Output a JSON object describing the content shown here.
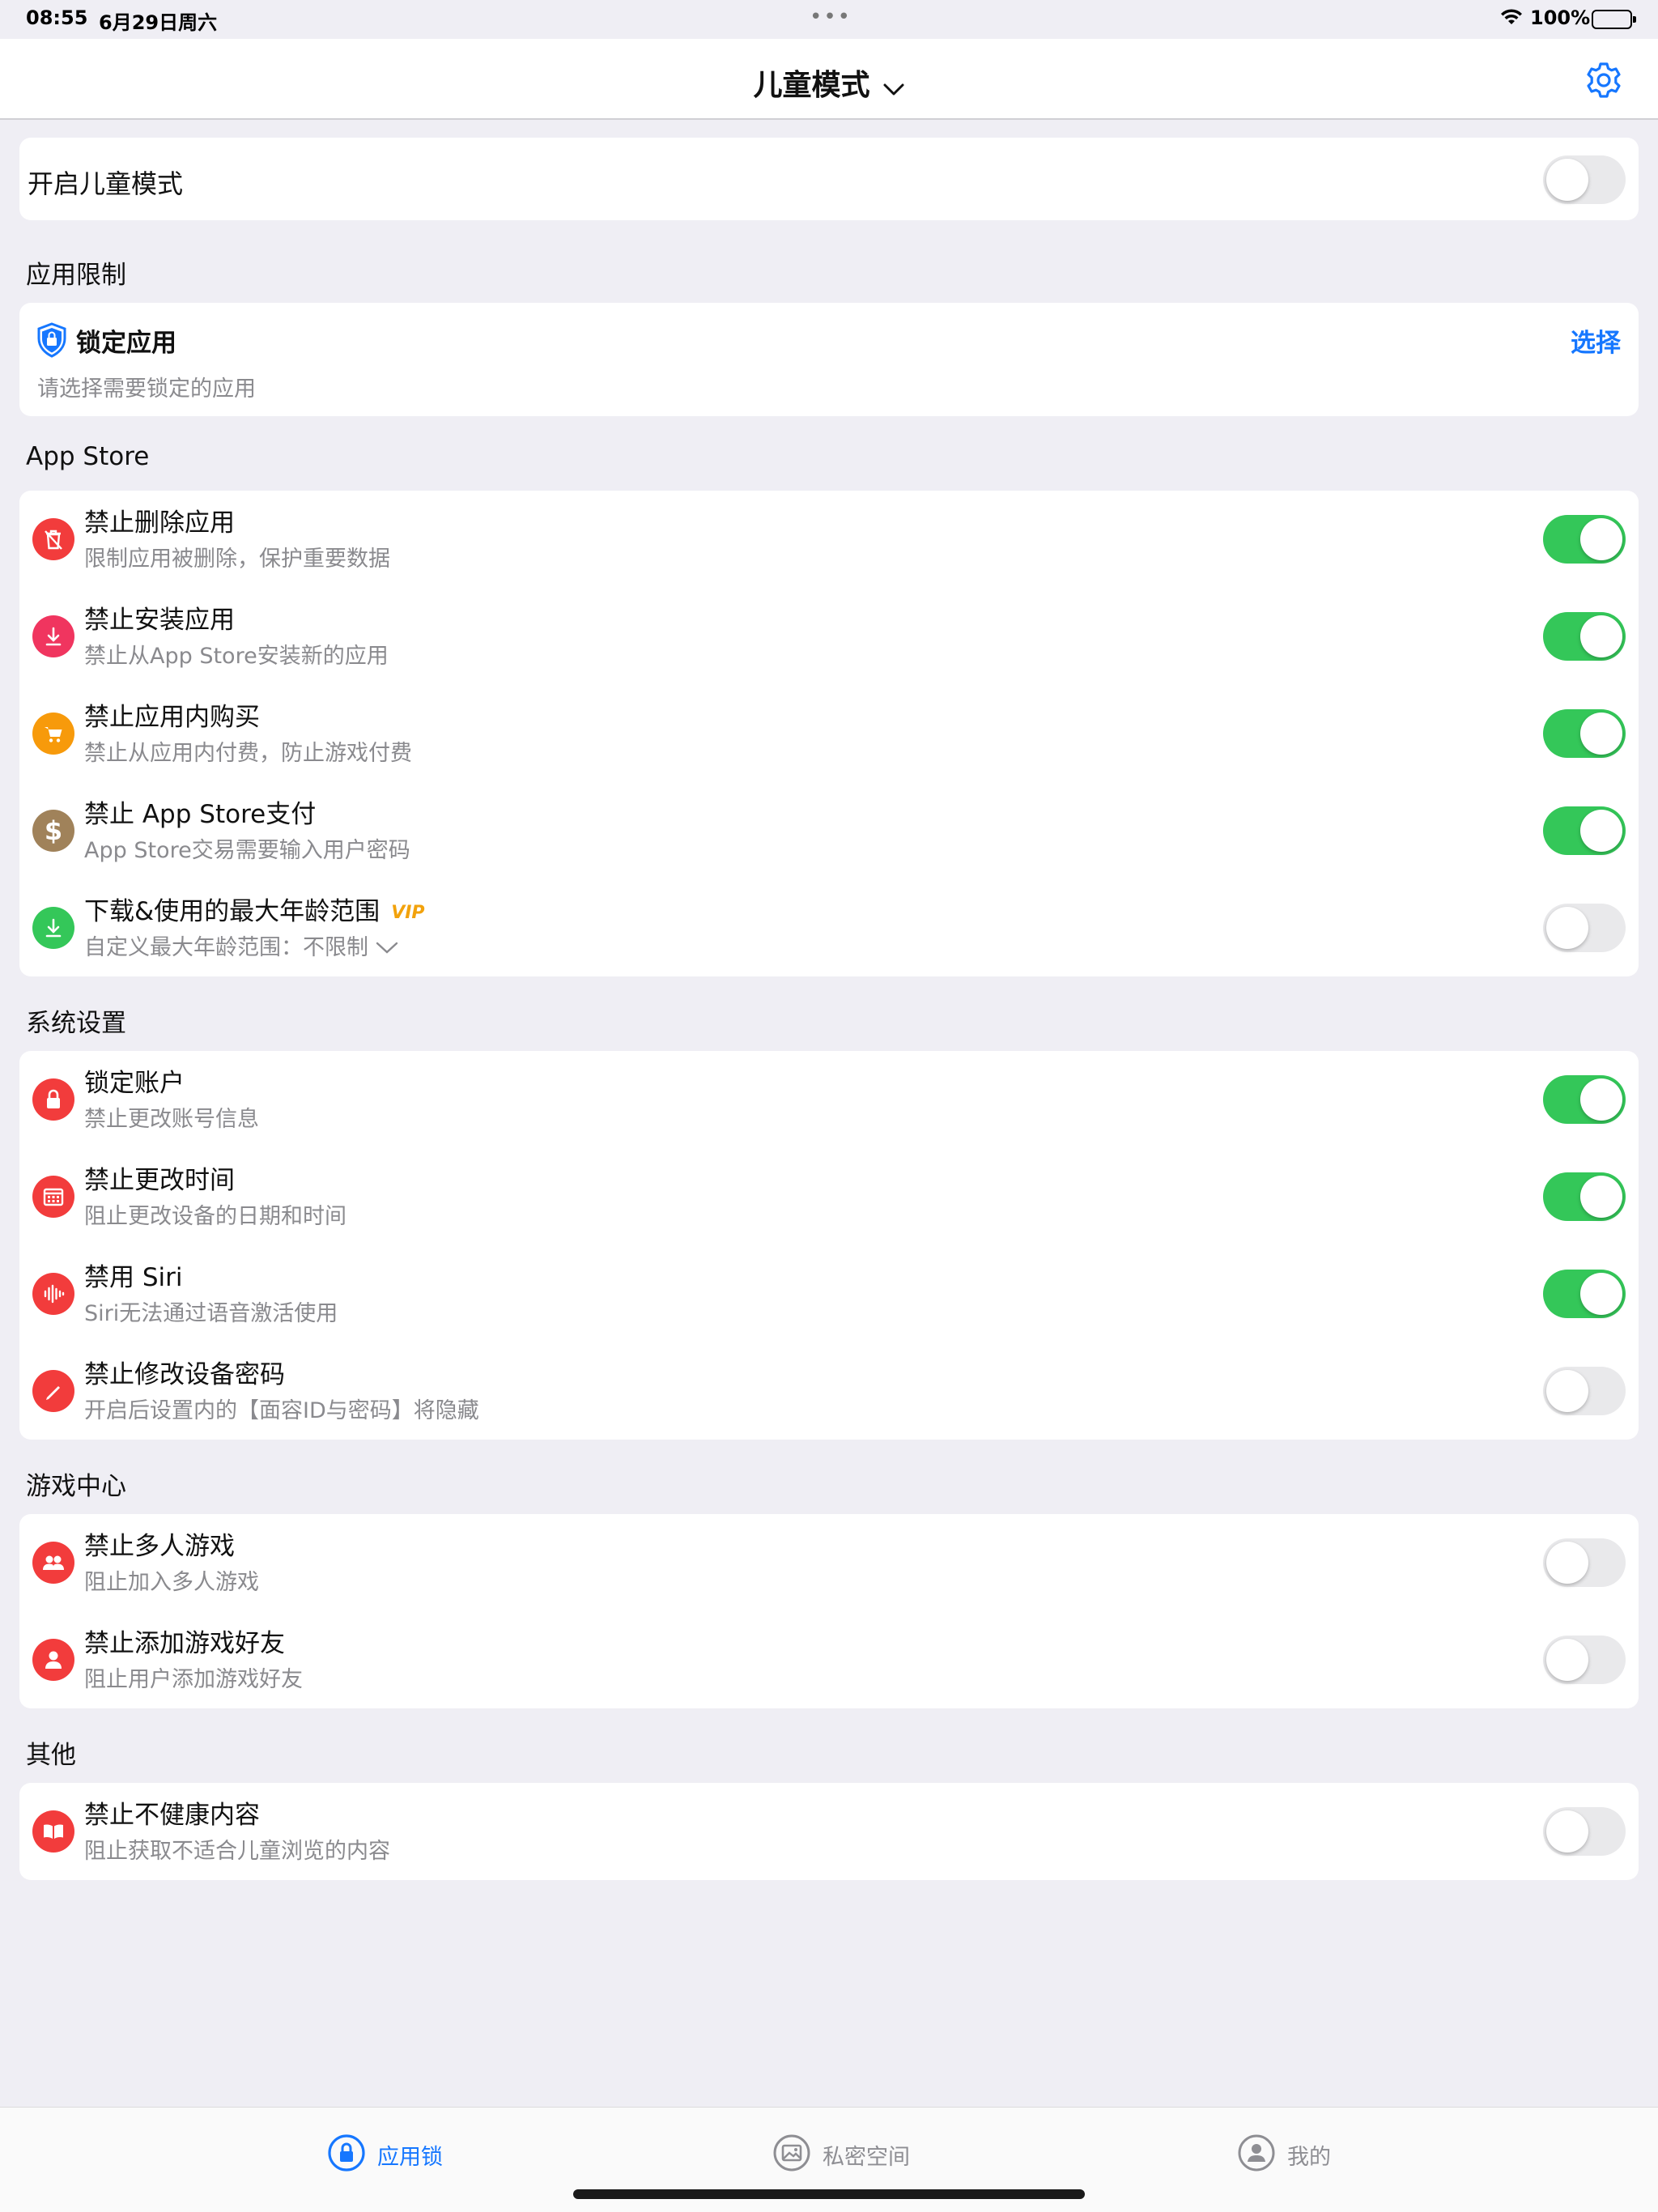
{
  "status": {
    "time": "08:55",
    "date": "6月29日周六",
    "dots": "•••",
    "battery": "100%"
  },
  "nav": {
    "title": "儿童模式"
  },
  "top_toggle": {
    "label": "开启儿童模式",
    "on": false
  },
  "app_limit": {
    "header": "应用限制",
    "title": "锁定应用",
    "subtitle": "请选择需要锁定的应用",
    "action": "选择"
  },
  "sections": [
    {
      "header": "App Store",
      "rows": [
        {
          "title": "禁止删除应用",
          "subtitle": "限制应用被删除，保护重要数据",
          "icon": "trash-icon",
          "icon_color": "#f23c3c",
          "on": true
        },
        {
          "title": "禁止安装应用",
          "subtitle": "禁止从App Store安装新的应用",
          "icon": "download-icon",
          "icon_color": "#f0355f",
          "on": true
        },
        {
          "title": "禁止应用内购买",
          "subtitle": "禁止从应用内付费，防止游戏付费",
          "icon": "cart-icon",
          "icon_color": "#f79a0b",
          "on": true
        },
        {
          "title": "禁止 App Store支付",
          "subtitle": "App Store交易需要输入用户密码",
          "icon": "dollar-icon",
          "icon_color": "#a0825a",
          "on": true
        },
        {
          "title": "下载&使用的最大年龄范围",
          "subtitle": "自定义最大年龄范围：不限制",
          "icon": "download-icon",
          "icon_color": "#34c759",
          "on": false,
          "vip": "VIP",
          "has_dropdown": true
        }
      ]
    },
    {
      "header": "系统设置",
      "rows": [
        {
          "title": "锁定账户",
          "subtitle": "禁止更改账号信息",
          "icon": "lock-icon",
          "icon_color": "#f23c3c",
          "on": true
        },
        {
          "title": "禁止更改时间",
          "subtitle": "阻止更改设备的日期和时间",
          "icon": "calendar-icon",
          "icon_color": "#f23c3c",
          "on": true
        },
        {
          "title": "禁用 Siri",
          "subtitle": "Siri无法通过语音激活使用",
          "icon": "waveform-icon",
          "icon_color": "#f23c3c",
          "on": true
        },
        {
          "title": "禁止修改设备密码",
          "subtitle": "开启后设置内的【面容ID与密码】将隐藏",
          "icon": "pencil-icon",
          "icon_color": "#f23c3c",
          "on": false
        }
      ]
    },
    {
      "header": "游戏中心",
      "rows": [
        {
          "title": "禁止多人游戏",
          "subtitle": "阻止加入多人游戏",
          "icon": "people-icon",
          "icon_color": "#f23c3c",
          "on": false
        },
        {
          "title": "禁止添加游戏好友",
          "subtitle": "阻止用户添加游戏好友",
          "icon": "person-icon",
          "icon_color": "#f23c3c",
          "on": false
        }
      ]
    },
    {
      "header": "其他",
      "rows": [
        {
          "title": "禁止不健康内容",
          "subtitle": "阻止获取不适合儿童浏览的内容",
          "icon": "book-icon",
          "icon_color": "#f23c3c",
          "on": false
        }
      ]
    }
  ],
  "tabs": [
    {
      "label": "应用锁",
      "icon": "lock-circle-icon",
      "active": true
    },
    {
      "label": "私密空间",
      "icon": "photo-icon",
      "active": false
    },
    {
      "label": "我的",
      "icon": "user-circle-icon",
      "active": false
    }
  ],
  "colors": {
    "accent": "#1677ff",
    "toggle_on": "#34c759",
    "background": "#efeef4"
  }
}
